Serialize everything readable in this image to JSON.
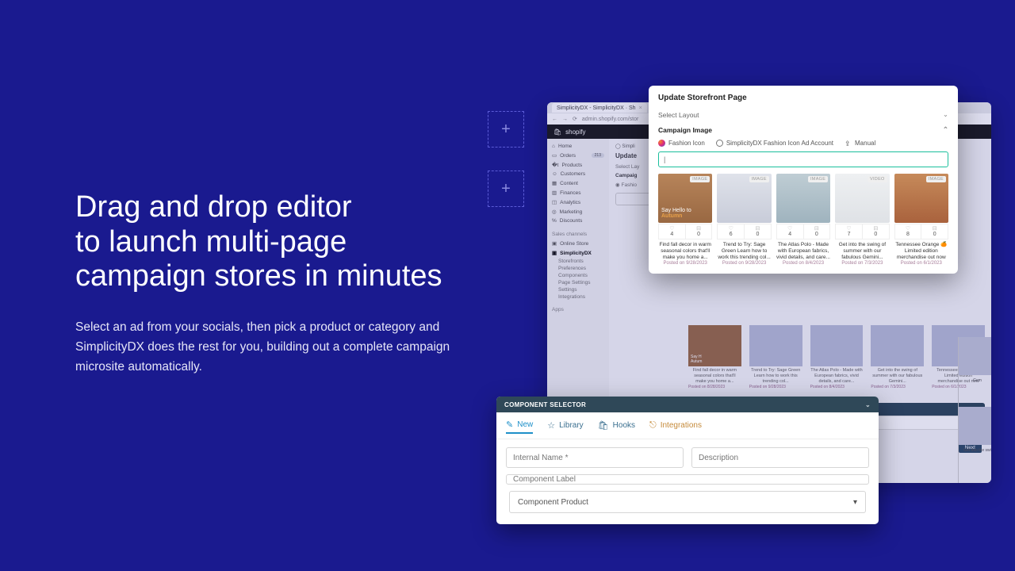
{
  "hero": {
    "heading": "Drag and drop editor\nto launch multi-page\ncampaign stores in minutes",
    "sub": "Select an ad from your socials, then pick a product or category and SimplicityDX does the rest for you, building out a complete campaign microsite automatically."
  },
  "deco": {
    "plus": "+"
  },
  "admin": {
    "tab_title": "SimplicityDX - SimplicityDX · Sh",
    "tab_plus": "+",
    "url_bar": "admin.shopify.com/stor",
    "back": "←",
    "fwd": "→",
    "reload": "⟳",
    "brand_icon": "🛍",
    "brand": "shopify",
    "nav": [
      "Home",
      "Orders",
      "Products",
      "Customers",
      "Content",
      "Finances",
      "Analytics",
      "Marketing",
      "Discounts"
    ],
    "orders_badge": "213",
    "section_sales": "Sales channels",
    "sales_items": [
      "Online Store",
      "SimplicityDX"
    ],
    "simp_sub": [
      "Storefronts",
      "Preferences",
      "Components",
      "Page Settings",
      "Settings",
      "Integrations"
    ],
    "section_apps": "Apps",
    "crumb_icon": "Simpli",
    "update_heading": "Update",
    "select_lay": "Select Lay",
    "campaign": "Campaig",
    "fashio": "Fashio",
    "ghost_cards": [
      {
        "title": "Find fall decor in warm seasonal colors that'll make you home a...",
        "date": "Posted on 8/28/2023"
      },
      {
        "title": "Trend to Try: Sage Green Learn how to work this trending col...",
        "date": "Posted on 9/28/2023"
      },
      {
        "title": "The Atlas Polo - Made with European fabrics, vivid details, and care...",
        "date": "Posted on 8/4/2023"
      },
      {
        "title": "Get into the swing of summer with our fabulous Gemini...",
        "date": "Posted on 7/3/2023"
      },
      {
        "title": "Tennessee Orange 🍊 Limited edition merchandise out now",
        "date": "Posted on 6/1/2023"
      }
    ],
    "ghost_overlay_caption": "Say H\nAutum",
    "comp_sel_title": "COMPONENT SELECTOR",
    "csb_new": "New",
    "csb_lib": "Library",
    "csb_hooks": "Hooks",
    "csb_int": "Integrations",
    "next": "Next",
    "rp_caption1": "Gem",
    "rp_caption2": "Get into the swi"
  },
  "popover": {
    "title": "Update Storefront Page",
    "row_select": "Select Layout",
    "row_campaign": "Campaign Image",
    "chev_down": "⌄",
    "chev_up": "⌃",
    "src": {
      "fashion": "Fashion Icon",
      "ad_account": "SimplicityDX Fashion Icon Ad Account",
      "manual": "Manual",
      "upload_icon": "⇪"
    },
    "search_placeholder": "|",
    "badge_image": "IMAGE",
    "badge_video": "VIDEO",
    "heart": "♡",
    "comment_icon": "⊟",
    "cards": [
      {
        "likes": "4",
        "comments": "0",
        "title": "Find fall decor in warm seasonal colors that'll make you home a...",
        "date": "Posted on 9/28/2023",
        "cap_line1": "Say Hello to",
        "cap_line2": "Autumn",
        "badge": "IMAGE"
      },
      {
        "likes": "6",
        "comments": "0",
        "title": "Trend to Try: Sage Green Learn how to work this trending col...",
        "date": "Posted on 9/28/2023",
        "badge": "IMAGE"
      },
      {
        "likes": "4",
        "comments": "0",
        "title": "The Atlas Polo - Made with European fabrics, vivid details, and care...",
        "date": "Posted on 8/4/2023",
        "badge": "IMAGE"
      },
      {
        "likes": "7",
        "comments": "0",
        "title": "Get into the swing of summer with our fabulous Gemini...",
        "date": "Posted on 7/3/2023",
        "badge": "VIDEO"
      },
      {
        "likes": "8",
        "comments": "0",
        "title": "Tennessee Orange 🍊 Limited edition merchandise out now",
        "date": "Posted on 6/1/2023",
        "badge": "IMAGE"
      }
    ]
  },
  "comp": {
    "title": "COMPONENT SELECTOR",
    "chev": "⌄",
    "tabs": {
      "new": "New",
      "library": "Library",
      "hooks": "Hooks",
      "integrations": "Integrations"
    },
    "icons": {
      "new": "✎",
      "library": "☆",
      "hooks": "🛍",
      "integrations": "⎋"
    },
    "internal_name": "Internal Name *",
    "description": "Description",
    "component_label": "Component Label",
    "component_product": "Component Product",
    "select_arrow": "▾"
  }
}
